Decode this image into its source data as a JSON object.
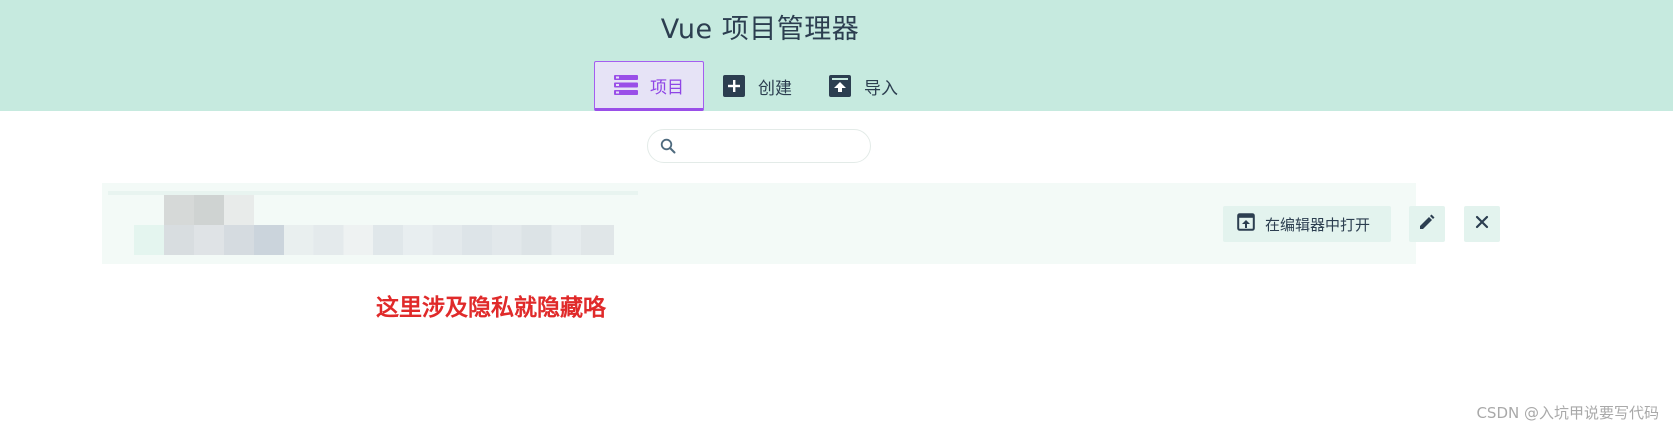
{
  "header": {
    "title": "Vue 项目管理器",
    "tabs": [
      {
        "label": "项目",
        "icon": "list-icon",
        "active": true
      },
      {
        "label": "创建",
        "icon": "add-box-icon",
        "active": false
      },
      {
        "label": "导入",
        "icon": "unarchive-icon",
        "active": false
      }
    ]
  },
  "search": {
    "value": "",
    "placeholder": ""
  },
  "project": {
    "actions": {
      "open_in_editor_label": "在编辑器中打开",
      "open_icon": "open-in-browser-icon",
      "edit_icon": "pencil-icon",
      "remove_icon": "close-icon"
    }
  },
  "annotation": {
    "text": "这里涉及隐私就隐藏咯"
  },
  "watermark": {
    "text": "CSDN @入坑甲说要写代码"
  },
  "colors": {
    "header_bg": "#c6eadf",
    "accent": "#9a4fe8",
    "row_bg": "#f3faf7",
    "annotation": "#e02a2a"
  }
}
